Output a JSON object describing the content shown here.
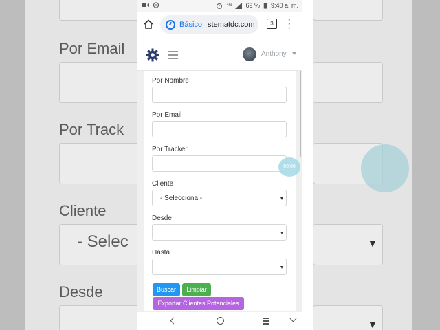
{
  "statusbar": {
    "battery": "69 %",
    "time": "9:40 a. m.",
    "signal": "4G"
  },
  "browser": {
    "mode_label": "Básico",
    "url": "stematdc.com",
    "tab_count": "3"
  },
  "header": {
    "username": "Anthony"
  },
  "form": {
    "name_label": "Por Nombre",
    "email_label": "Por Email",
    "tracker_label": "Por Tracker",
    "client_label": "Cliente",
    "client_selected": "- Selecciona -",
    "from_label": "Desde",
    "to_label": "Hasta"
  },
  "buttons": {
    "search": "Buscar",
    "clear": "Limpiar",
    "export": "Exportar Clientes Potenciales"
  },
  "timer": "00:00",
  "background": {
    "email_label": "Por Email",
    "tracker_label": "Por Track",
    "client_label": "Cliente",
    "select_text": "- Selec",
    "from_label": "Desde"
  },
  "colors": {
    "search_button": "#2196f3",
    "clear_button": "#4caf50",
    "export_button": "#b565e0",
    "gear_icon": "#2c3e6e"
  }
}
